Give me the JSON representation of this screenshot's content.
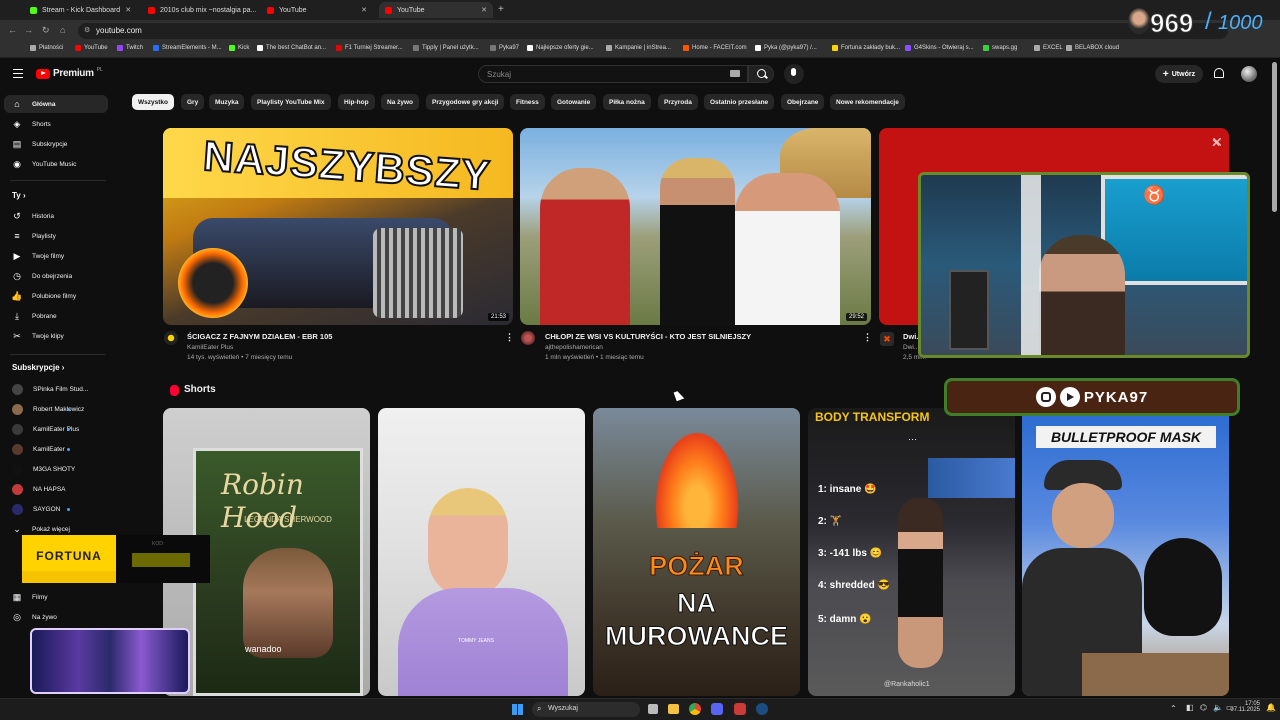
{
  "browser": {
    "tabs": [
      {
        "label": "Stream - Kick Dashboard",
        "favicon_color": "#53fc18"
      },
      {
        "label": "2010s club mix ~nostalgia pa...",
        "favicon_color": "#ff0000"
      },
      {
        "label": "YouTube",
        "favicon_color": "#ff0000"
      },
      {
        "label": "YouTube",
        "favicon_color": "#ff0000"
      }
    ],
    "address": "youtube.com",
    "bookmarks": [
      {
        "label": "Płatności",
        "color": "#aaaaaa"
      },
      {
        "label": "YouTube",
        "color": "#ff0000"
      },
      {
        "label": "Twitch",
        "color": "#9146ff"
      },
      {
        "label": "StreamElements - M...",
        "color": "#2a6cf5"
      },
      {
        "label": "Kick",
        "color": "#53fc18"
      },
      {
        "label": "The best ChatBot an...",
        "color": "#ffffff"
      },
      {
        "label": "F1 Turniej Streamer...",
        "color": "#e10600"
      },
      {
        "label": "Tipply | Panel użytk...",
        "color": "#777777"
      },
      {
        "label": "Pyka97",
        "color": "#777777"
      },
      {
        "label": "Najlepsze oferty gie...",
        "color": "#ffffff"
      },
      {
        "label": "Kampanie | inStrea...",
        "color": "#aaaaaa"
      },
      {
        "label": "Home - FACEIT.com",
        "color": "#ff5500"
      },
      {
        "label": "Pyka (@pyka97) /...",
        "color": "#ffffff"
      },
      {
        "label": "Fortuna zakłady buk...",
        "color": "#ffd200"
      },
      {
        "label": "G4Skins - Otwieraj s...",
        "color": "#8a4fff"
      },
      {
        "label": "swaps.gg",
        "color": "#3ecf3e"
      },
      {
        "label": "EXCEL",
        "color": "#aaaaaa"
      },
      {
        "label": "BELABOX cloud",
        "color": "#aaaaaa"
      }
    ]
  },
  "header": {
    "logo": "Premium",
    "logo_region": "PL",
    "search_placeholder": "Szukaj",
    "create_label": "Utwórz"
  },
  "chips": [
    "Wszystko",
    "Gry",
    "Muzyka",
    "Playlisty YouTube Mix",
    "Hip-hop",
    "Na żywo",
    "Przygodowe gry akcji",
    "Fitness",
    "Gotowanie",
    "Piłka nożna",
    "Przyroda",
    "Ostatnio przesłane",
    "Obejrzane",
    "Nowe rekomendacje"
  ],
  "sidebar": {
    "main": [
      {
        "label": "Główna",
        "icon": "home-icon",
        "glyph": "⌂"
      },
      {
        "label": "Shorts",
        "icon": "shorts-icon",
        "glyph": "◈"
      },
      {
        "label": "Subskrypcje",
        "icon": "subscriptions-icon",
        "glyph": "▤"
      },
      {
        "label": "YouTube Music",
        "icon": "music-icon",
        "glyph": "◉"
      }
    ],
    "you_header": "Ty",
    "you": [
      {
        "label": "Historia",
        "icon": "history-icon",
        "glyph": "↺"
      },
      {
        "label": "Playlisty",
        "icon": "playlists-icon",
        "glyph": "≡"
      },
      {
        "label": "Twoje filmy",
        "icon": "your-videos-icon",
        "glyph": "▶"
      },
      {
        "label": "Do obejrzenia",
        "icon": "watch-later-icon",
        "glyph": "◷"
      },
      {
        "label": "Polubione filmy",
        "icon": "liked-icon",
        "glyph": "👍"
      },
      {
        "label": "Pobrane",
        "icon": "download-icon",
        "glyph": "⤓"
      },
      {
        "label": "Twoje klipy",
        "icon": "clips-icon",
        "glyph": "✂"
      }
    ],
    "subs_header": "Subskrypcje",
    "subs": [
      {
        "label": "SPinka Film Stud...",
        "color": "#444444",
        "dot": false
      },
      {
        "label": "Robert Makłowicz",
        "color": "#8a6a4a",
        "dot": true
      },
      {
        "label": "KamilEater Plus",
        "color": "#3a3a3a",
        "dot": true
      },
      {
        "label": "KamilEater",
        "color": "#5a3a2a",
        "dot": true
      },
      {
        "label": "M3GA SHOTY",
        "color": "#111111",
        "dot": false
      },
      {
        "label": "NA HAPSA",
        "color": "#c23a3a",
        "dot": false
      },
      {
        "label": "SAYGON",
        "color": "#2a2a6a",
        "dot": true
      }
    ],
    "more": "Pokaż więcej",
    "explore": [
      {
        "label": "Filmy",
        "icon": "movies-icon",
        "glyph": "▦"
      },
      {
        "label": "Na żywo",
        "icon": "live-icon",
        "glyph": "◎"
      }
    ]
  },
  "videos": [
    {
      "title": "ŚCIGACZ Z FAJNYM DZIAŁEM - EBR 105",
      "channel": "KamilEater Plus",
      "meta": "14 tys. wyświetleń • 7 miesięcy temu",
      "duration": "21:53",
      "thumb_text": "NAJSZYBSZY"
    },
    {
      "title": "CHŁOPI ZE WSI VS KULTURYŚCI - KTO JEST SILNIEJSZY",
      "channel": "ajthepolishamerican",
      "meta": "1 mln wyświetleń • 1 miesiąc temu",
      "duration": "29:52"
    },
    {
      "title": "Dwi...",
      "channel": "Dwi...",
      "meta": "2,5 mi..."
    }
  ],
  "shorts": {
    "header": "Shorts",
    "items": [
      {
        "title_text": "Robin Hood",
        "sub_text": "LEGENDA SHERWOOD",
        "brand": "wanadoo"
      },
      {
        "title_text": "",
        "sub_text": "TOMMY JEANS"
      },
      {
        "line1": "POŻAR",
        "line2": "NA",
        "line3": "MUROWANCE"
      },
      {
        "header": "BODY TRANSFORM",
        "ranks": [
          "1: insane 🤩",
          "2: 🏋",
          "3: -141 lbs 😊",
          "4: shredded 😎",
          "5: damn 😮"
        ],
        "watermark": "@Rankaholic1"
      },
      {
        "header": "BULLETPROOF MASK"
      }
    ]
  },
  "overlays": {
    "counter_current": "969",
    "counter_total": "1000",
    "handle": "PYKA97",
    "fortuna": "FORTUNA",
    "fortuna_code_label": "KOD:"
  },
  "taskbar": {
    "search": "Wyszukaj",
    "time": "17:05",
    "date": "07.11.2025"
  }
}
